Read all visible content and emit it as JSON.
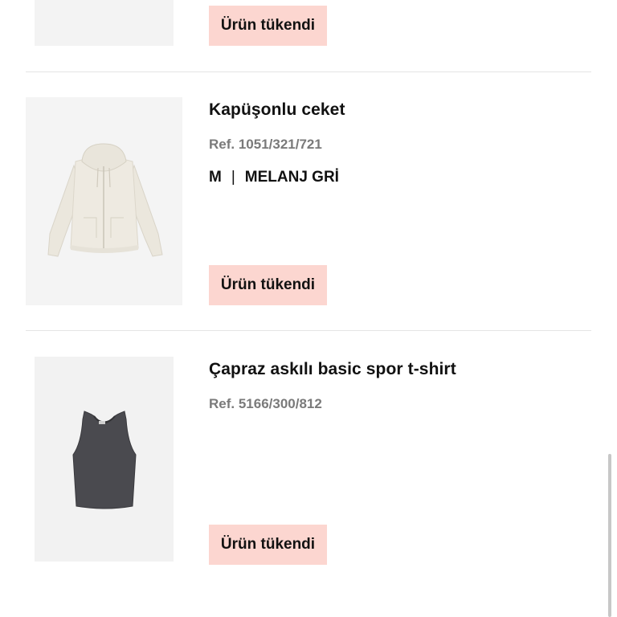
{
  "items": [
    {
      "sold_out_label": "Ürün tükendi"
    },
    {
      "name": "Kapüşonlu ceket",
      "ref": "Ref. 1051/321/721",
      "size": "M",
      "separator": "|",
      "color": "MELANJ GRİ",
      "sold_out_label": "Ürün tükendi",
      "image_icon": "hoodie-icon"
    },
    {
      "name": "Çapraz askılı basic spor t-shirt",
      "ref": "Ref. 5166/300/812",
      "sold_out_label": "Ürün tükendi",
      "image_icon": "tank-top-icon"
    }
  ],
  "colors": {
    "sold_out_bg": "#fcd6d0",
    "ref_text": "#7a7a7a",
    "divider": "#e4e4e4",
    "image_bg": "#f3f3f3"
  }
}
